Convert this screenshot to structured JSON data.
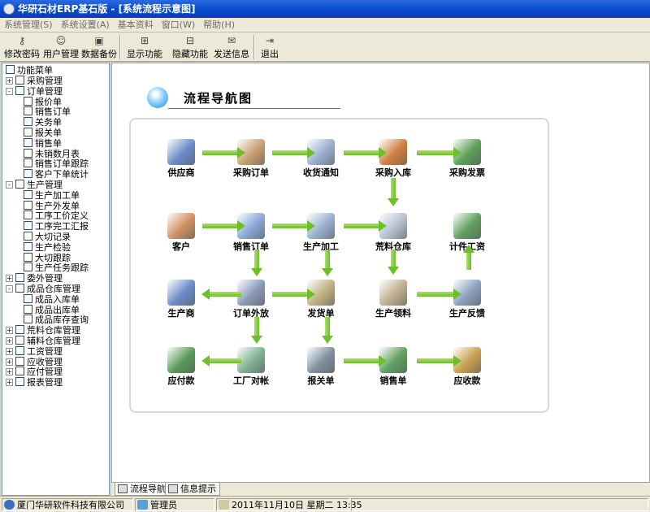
{
  "window": {
    "title": "华研石材ERP基石版  - [系统流程示意图]"
  },
  "menu": [
    "系统管理(S)",
    "系统设置(A)",
    "基本资料",
    "窗口(W)",
    "帮助(H)"
  ],
  "toolbar": {
    "buttons": [
      {
        "label": "修改密码",
        "icon": "key-icon"
      },
      {
        "label": "用户管理",
        "icon": "user-icon"
      },
      {
        "label": "数据备份",
        "icon": "disk-icon"
      },
      {
        "label": "显示功能树",
        "icon": "tree-show-icon"
      },
      {
        "label": "隐藏功能树",
        "icon": "tree-hide-icon"
      },
      {
        "label": "发送信息",
        "icon": "message-icon"
      },
      {
        "label": "退出",
        "icon": "exit-icon"
      }
    ]
  },
  "tree": {
    "root": "功能菜单",
    "items": [
      {
        "label": "采购管理",
        "level": 1,
        "expander": "+"
      },
      {
        "label": "订单管理",
        "level": 1,
        "expander": "-"
      },
      {
        "label": "报价单",
        "level": 2
      },
      {
        "label": "销售订单",
        "level": 2
      },
      {
        "label": "关务单",
        "level": 2
      },
      {
        "label": "报关单",
        "level": 2
      },
      {
        "label": "销售单",
        "level": 2
      },
      {
        "label": "未销数月表",
        "level": 2
      },
      {
        "label": "销售订单跟踪",
        "level": 2
      },
      {
        "label": "客户下单统计",
        "level": 2
      },
      {
        "label": "生产管理",
        "level": 1,
        "expander": "-"
      },
      {
        "label": "生产加工单",
        "level": 2
      },
      {
        "label": "生产外发单",
        "level": 2
      },
      {
        "label": "工序工价定义",
        "level": 2
      },
      {
        "label": "工序完工汇报",
        "level": 2
      },
      {
        "label": "大切记录",
        "level": 2
      },
      {
        "label": "生产检验",
        "level": 2
      },
      {
        "label": "大切跟踪",
        "level": 2
      },
      {
        "label": "生产任务跟踪",
        "level": 2
      },
      {
        "label": "委外管理",
        "level": 1,
        "expander": "+"
      },
      {
        "label": "成品仓库管理",
        "level": 1,
        "expander": "-"
      },
      {
        "label": "成品入库单",
        "level": 2
      },
      {
        "label": "成品出库单",
        "level": 2
      },
      {
        "label": "成品库存查询",
        "level": 2
      },
      {
        "label": "荒料仓库管理",
        "level": 1,
        "expander": "+"
      },
      {
        "label": "辅料仓库管理",
        "level": 1,
        "expander": "+"
      },
      {
        "label": "工资管理",
        "level": 1,
        "expander": "+"
      },
      {
        "label": "应收管理",
        "level": 1,
        "expander": "+"
      },
      {
        "label": "应付管理",
        "level": 1,
        "expander": "+"
      },
      {
        "label": "报表管理",
        "level": 1,
        "expander": "+"
      }
    ]
  },
  "flow": {
    "title": "流程导航图",
    "nodes": [
      {
        "id": "supplier",
        "label": "供应商",
        "icon": "supplier-icon",
        "color": "#6a8cc8"
      },
      {
        "id": "purchase_order",
        "label": "采购订单",
        "icon": "purchase-order-icon",
        "color": "#c8a070"
      },
      {
        "id": "receipt_notice",
        "label": "收货通知",
        "icon": "receipt-notice-icon",
        "color": "#9ab0d0"
      },
      {
        "id": "purchase_in",
        "label": "采购入库",
        "icon": "purchase-in-icon",
        "color": "#d08040"
      },
      {
        "id": "purchase_invoice",
        "label": "采购发票",
        "icon": "purchase-invoice-icon",
        "color": "#5aa05a"
      },
      {
        "id": "customer",
        "label": "客户",
        "icon": "customer-icon",
        "color": "#d09060"
      },
      {
        "id": "sales_order",
        "label": "销售订单",
        "icon": "sales-order-icon",
        "color": "#8aa8d8"
      },
      {
        "id": "production",
        "label": "生产加工",
        "icon": "production-icon",
        "color": "#9ab0d0"
      },
      {
        "id": "raw_warehouse",
        "label": "荒料仓库",
        "icon": "raw-warehouse-icon",
        "color": "#b8c0d0"
      },
      {
        "id": "piece_wage",
        "label": "计件工资",
        "icon": "piece-wage-icon",
        "color": "#60a060"
      },
      {
        "id": "producer",
        "label": "生产商",
        "icon": "producer-icon",
        "color": "#6a8cc8"
      },
      {
        "id": "order_outsource",
        "label": "订单外放",
        "icon": "order-outsource-icon",
        "color": "#8a9ab8"
      },
      {
        "id": "delivery_note",
        "label": "发货单",
        "icon": "delivery-note-icon",
        "color": "#c0b080"
      },
      {
        "id": "production_pick",
        "label": "生产领料",
        "icon": "production-pick-icon",
        "color": "#c0b090"
      },
      {
        "id": "production_feedback",
        "label": "生产反馈",
        "icon": "production-feedback-icon",
        "color": "#8aa0c0"
      },
      {
        "id": "payable",
        "label": "应付款",
        "icon": "payable-icon",
        "color": "#5a9a5a"
      },
      {
        "id": "factory_reconcile",
        "label": "工厂对帐",
        "icon": "factory-reconcile-icon",
        "color": "#80b090"
      },
      {
        "id": "customs_form",
        "label": "报关单",
        "icon": "customs-form-icon",
        "color": "#8090a0"
      },
      {
        "id": "sales_slip",
        "label": "销售单",
        "icon": "sales-slip-icon",
        "color": "#60a060"
      },
      {
        "id": "receivable",
        "label": "应收款",
        "icon": "receivable-icon",
        "color": "#c8a050"
      }
    ]
  },
  "tabs": [
    {
      "label": "流程导航",
      "active": true
    },
    {
      "label": "信息提示",
      "active": false
    }
  ],
  "status": {
    "company": "厦门华研软件科技有限公司",
    "user": "管理员",
    "datetime": "2011年11月10日 星期二     13:35"
  }
}
